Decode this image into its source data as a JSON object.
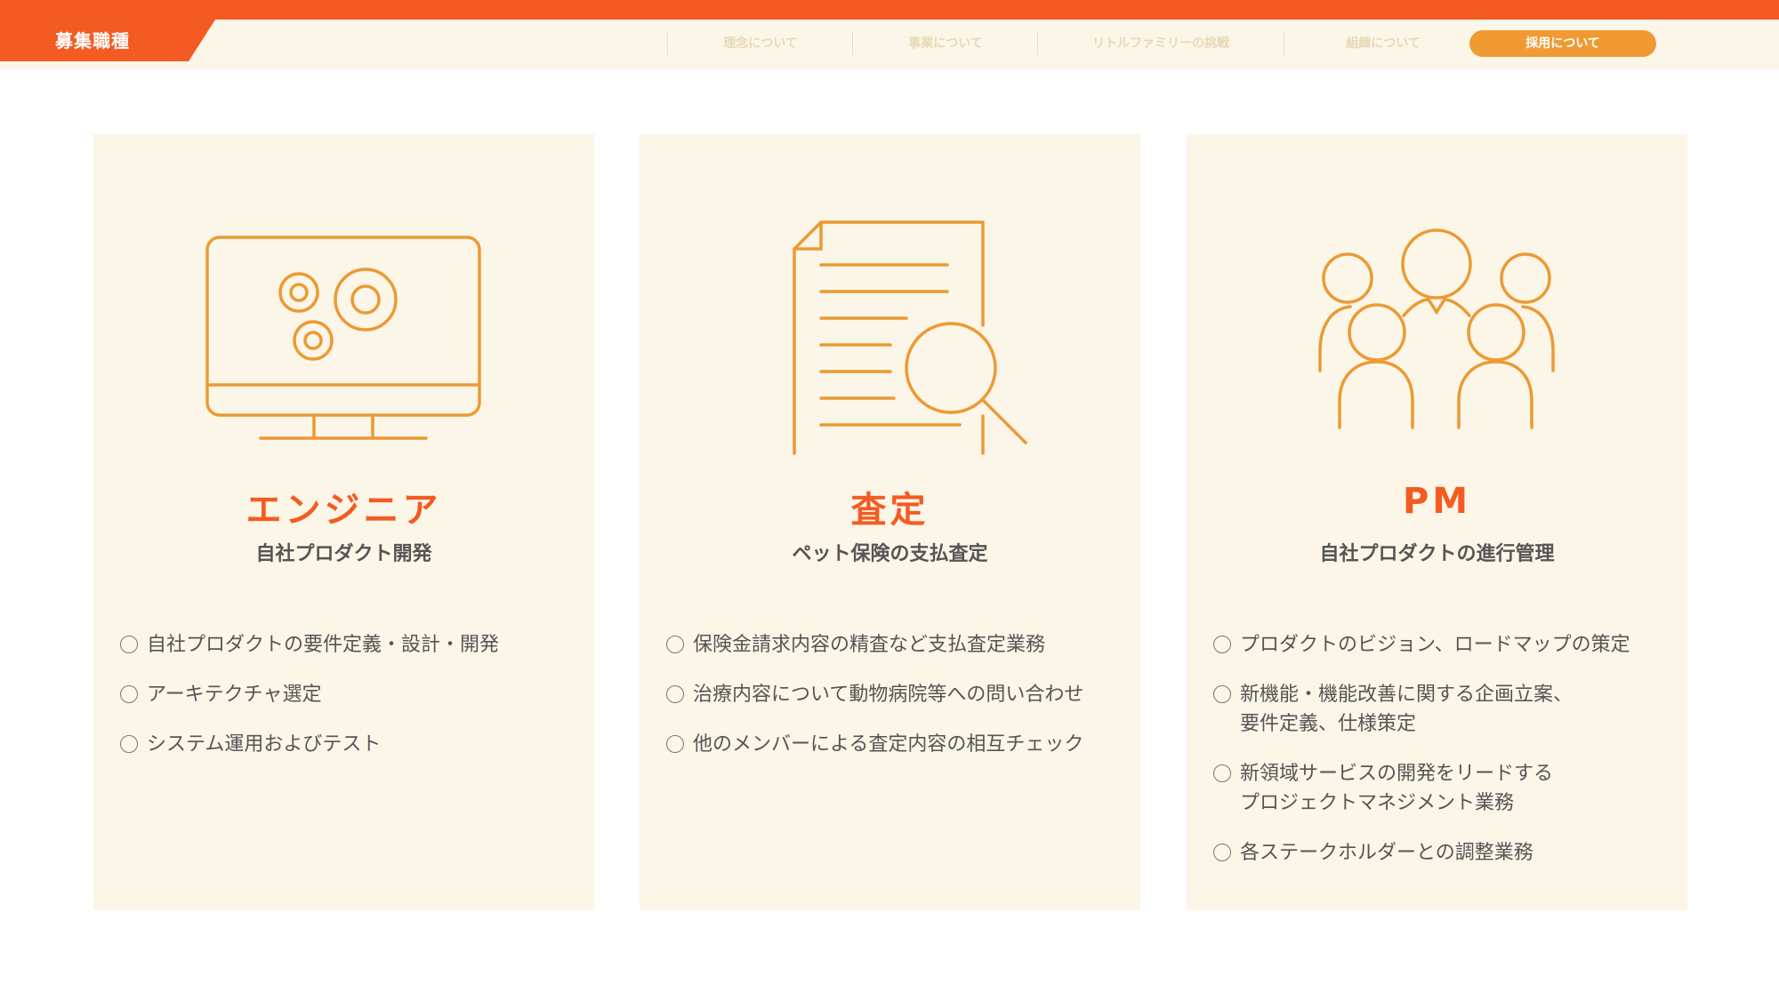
{
  "header": {
    "section_label": "募集職種"
  },
  "nav": {
    "items": [
      "理念について",
      "事業について",
      "リトルファミリーの挑戦",
      "組織について"
    ],
    "active": "採用について"
  },
  "cards": [
    {
      "icon": "monitor-gears-icon",
      "title": "エンジニア",
      "subtitle": "自社プロダクト開発",
      "bullets": [
        "自社プロダクトの要件定義・設計・開発",
        "アーキテクチャ選定",
        "システム運用およびテスト"
      ]
    },
    {
      "icon": "document-magnifier-icon",
      "title": "査定",
      "subtitle": "ペット保険の支払査定",
      "bullets": [
        "保険金請求内容の精査など支払査定業務",
        "治療内容について動物病院等への問い合わせ",
        "他のメンバーによる査定内容の相互チェック"
      ]
    },
    {
      "icon": "team-people-icon",
      "title": "PM",
      "subtitle": "自社プロダクトの進行管理",
      "bullets": [
        "プロダクトのビジョン、ロードマップの策定",
        "新機能・機能改善に関する企画立案、\n要件定義、仕様策定",
        "新領域サービスの開発をリードする\nプロジェクトマネジメント業務",
        "各ステークホルダーとの調整業務"
      ]
    }
  ],
  "colors": {
    "accent": "#f45b22",
    "icon": "#ec9a35",
    "card_bg": "#fbf6e7",
    "text": "#555555"
  }
}
